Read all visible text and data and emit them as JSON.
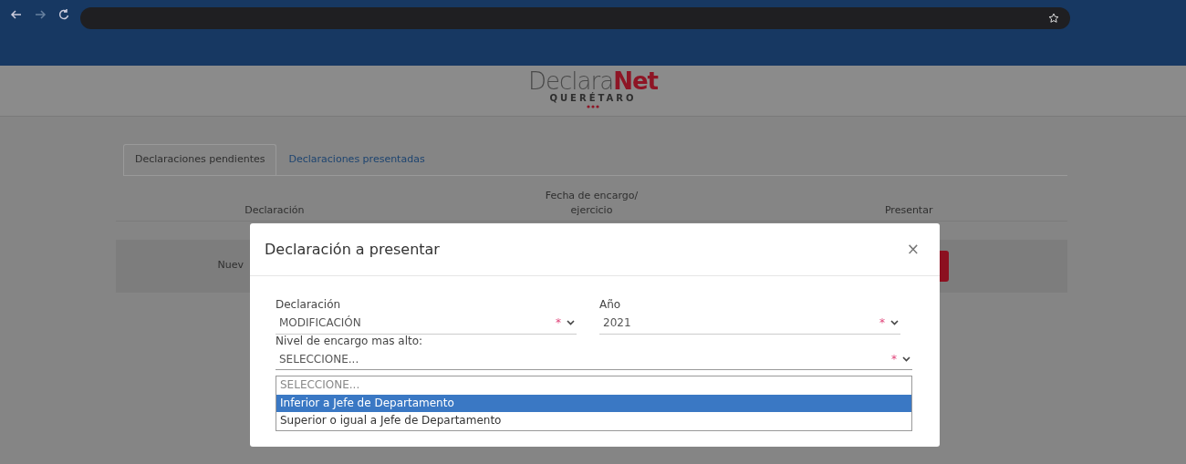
{
  "logo": {
    "brand_main": "Declara",
    "brand_accent": "Net",
    "subtitle": "QUERÉTARO"
  },
  "tabs": [
    {
      "label": "Declaraciones pendientes",
      "selected": true
    },
    {
      "label": "Declaraciones presentadas",
      "selected": false
    }
  ],
  "table": {
    "columns": [
      {
        "lines": [
          "Declaración"
        ]
      },
      {
        "lines": [
          "Fecha de encargo/",
          "ejercicio"
        ]
      },
      {
        "lines": [
          "Presentar"
        ]
      }
    ],
    "rows": [
      {
        "cells": [
          "Nuev"
        ],
        "has_button": true
      }
    ]
  },
  "modal": {
    "title": "Declaración a presentar",
    "close": "×",
    "fields": [
      {
        "label": "Declaración",
        "value": "MODIFICACIÓN",
        "required_mark": "*"
      },
      {
        "label": "Año",
        "value": "2021",
        "required_mark": "*"
      },
      {
        "label": "Nivel de encargo mas alto:",
        "value": "SELECCIONE...",
        "required_mark": "*",
        "expanded": true,
        "options": [
          {
            "label": "SELECCIONE...",
            "highlighted": false,
            "disabled": true
          },
          {
            "label": "Inferior a Jefe de Departamento",
            "highlighted": true,
            "disabled": false
          },
          {
            "label": "Superior o igual a Jefe de Departamento",
            "highlighted": false,
            "disabled": false
          }
        ]
      }
    ]
  }
}
